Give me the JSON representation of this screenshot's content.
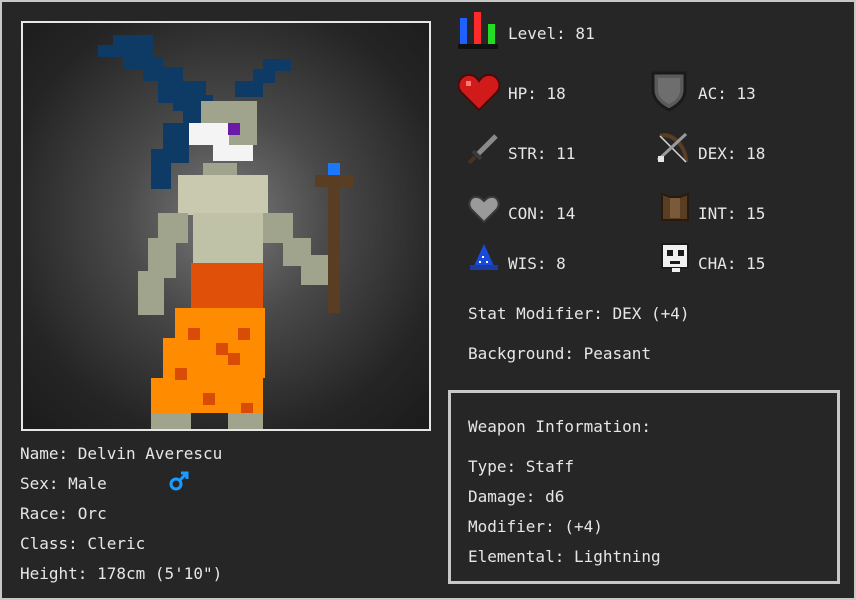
{
  "character": {
    "name_line": "Name: Delvin Averescu",
    "sex_line": "Sex: Male",
    "race_line": "Race: Orc",
    "class_line": "Class: Cleric",
    "height_line": "Height: 178cm (5'10\")"
  },
  "stats": {
    "level": "Level: 81",
    "hp": "HP: 18",
    "ac": "AC: 13",
    "str": "STR: 11",
    "dex": "DEX: 18",
    "con": "CON: 14",
    "int": "INT: 15",
    "wis": "WIS: 8",
    "cha": "CHA: 15"
  },
  "stat_modifier": "Stat Modifier: DEX (+4)",
  "background": "Background: Peasant",
  "weapon": {
    "heading": "Weapon Information:",
    "type": "Type: Staff",
    "damage": "Damage: d6",
    "modifier": "Modifier: (+4)",
    "elemental": "Elemental: Lightning"
  },
  "icons": {
    "level": "level-bars-icon",
    "hp": "heart-icon",
    "ac": "shield-icon",
    "str": "sword-icon",
    "dex": "bow-icon",
    "con": "grey-heart-icon",
    "int": "armor-icon",
    "wis": "wizard-hat-icon",
    "cha": "skull-face-icon",
    "sex": "male-symbol-icon"
  },
  "colors": {
    "background": "#262626",
    "text": "#e6e6e6",
    "hat": "#0e3a66",
    "skin": "#a0a48c",
    "robe": "#c9c9b0",
    "pants_top": "#e05008",
    "pants": "#ff8c00",
    "pants_spots": "#d84c08",
    "staff": "#5a3e24",
    "staff_gem": "#1a78ff",
    "eye": "#6a1aa8",
    "male_symbol": "#1a9cff"
  }
}
